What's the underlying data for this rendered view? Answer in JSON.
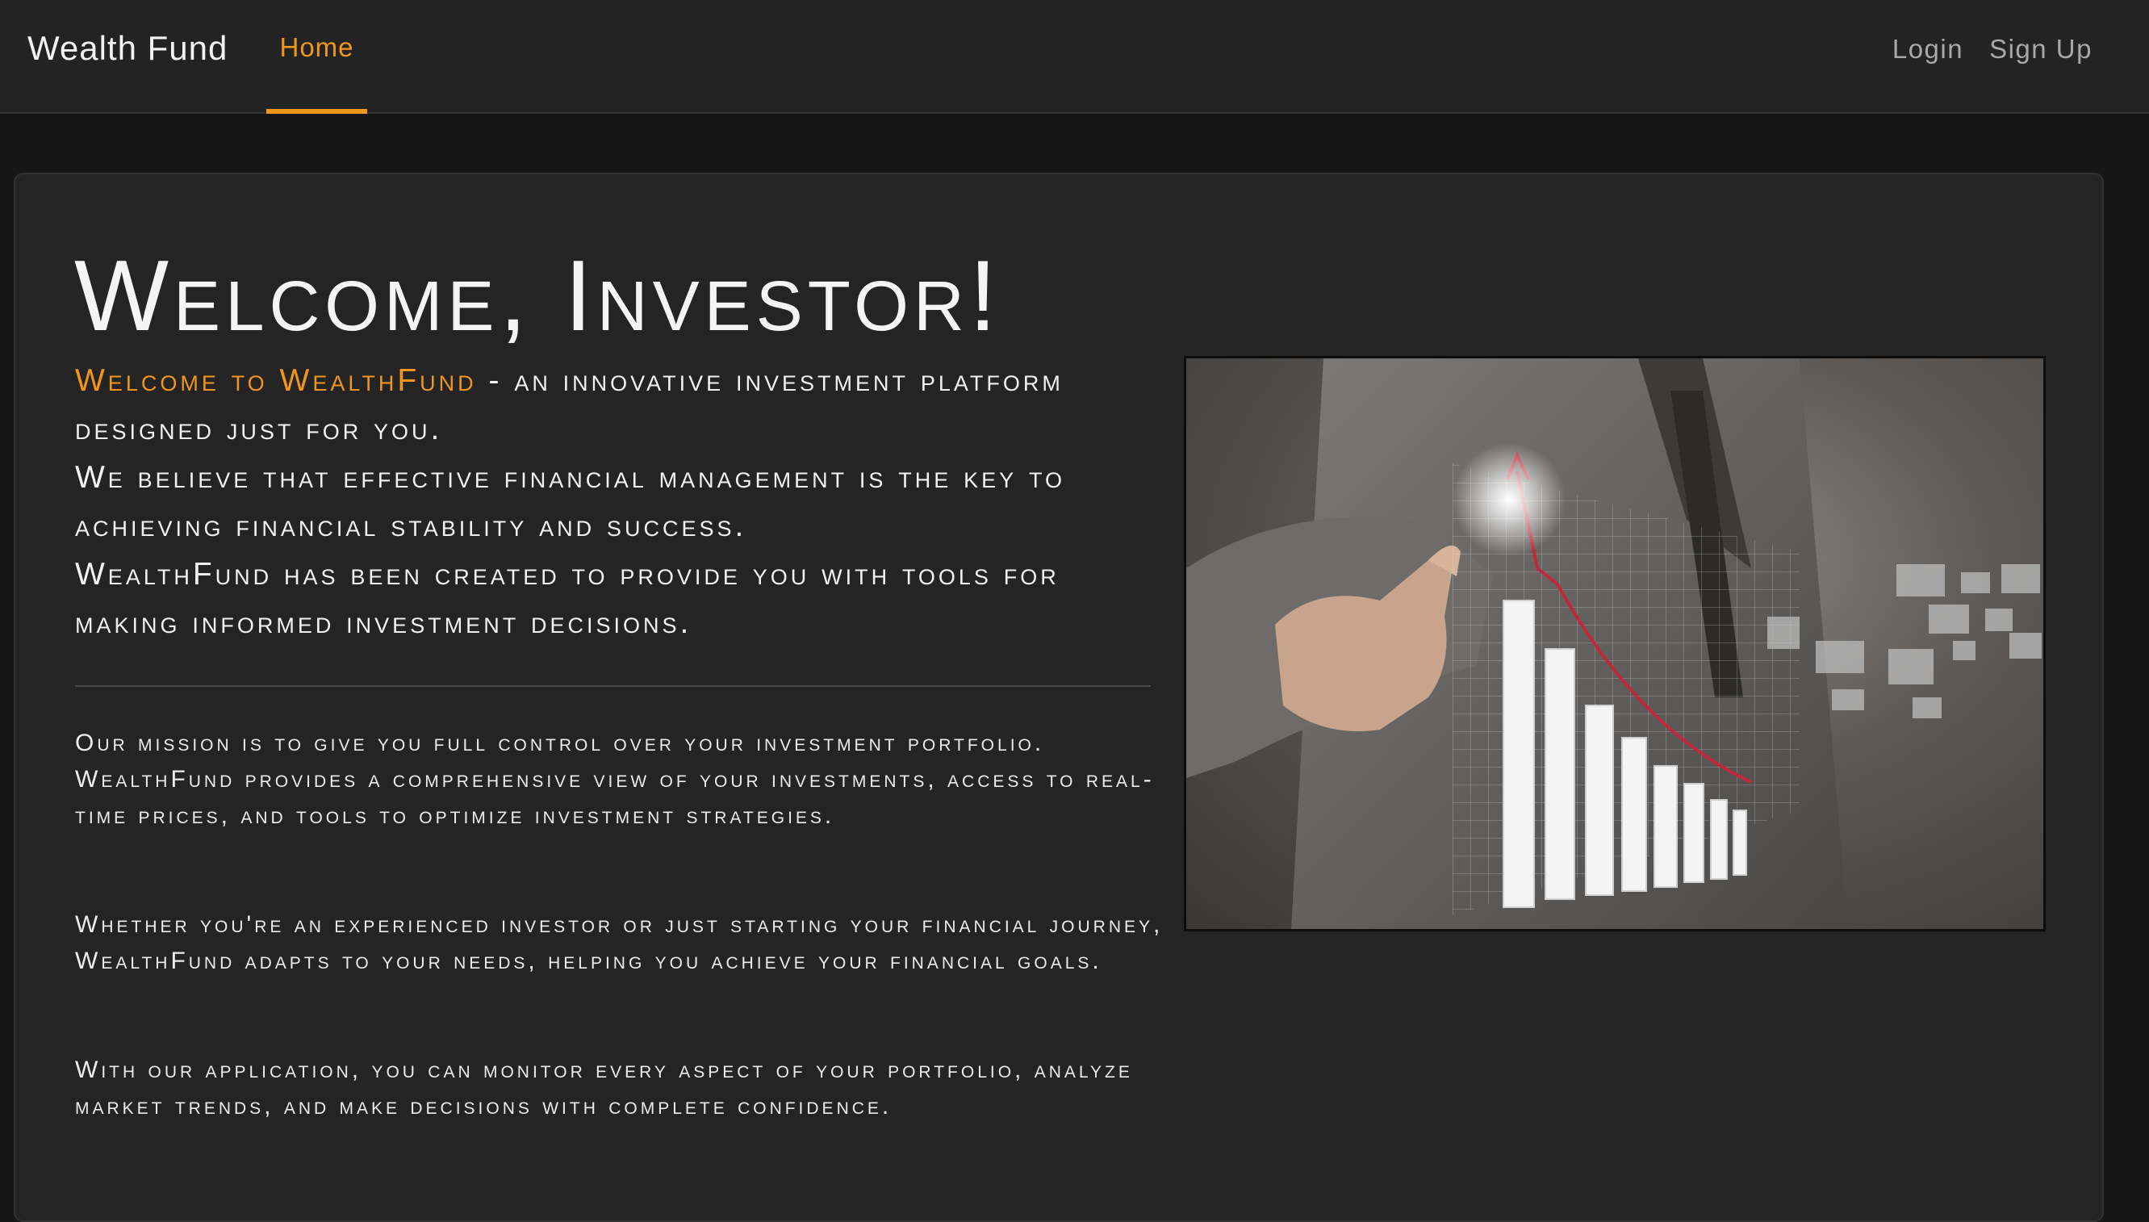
{
  "navbar": {
    "brand": "Wealth Fund",
    "home": "Home",
    "login": "Login",
    "signup": "Sign Up"
  },
  "main": {
    "title": "Welcome, Investor!",
    "intro_highlight": "Welcome to WealthFund",
    "intro_rest_1": " - an innovative investment platform designed just for you.",
    "intro_line_2": "We believe that effective financial management is the key to achieving financial stability and success.",
    "intro_line_3": "WealthFund has been created to provide you with tools for making informed investment decisions.",
    "paragraph_1": "Our mission is to give you full control over your investment portfolio. WealthFund provides a comprehensive view of your investments, access to real-time prices, and tools to optimize investment strategies.",
    "paragraph_2": "Whether you're an experienced investor or just starting your financial journey, WealthFund adapts to your needs, helping you achieve your financial goals.",
    "paragraph_3": "With our application, you can monitor every aspect of your portfolio, analyze market trends, and make decisions with complete confidence."
  },
  "colors": {
    "accent": "#f0961c",
    "background": "#161616",
    "navbar": "#232323",
    "card": "#242424"
  },
  "icons": {
    "hero_image": "businessman-touching-growth-chart-image"
  }
}
